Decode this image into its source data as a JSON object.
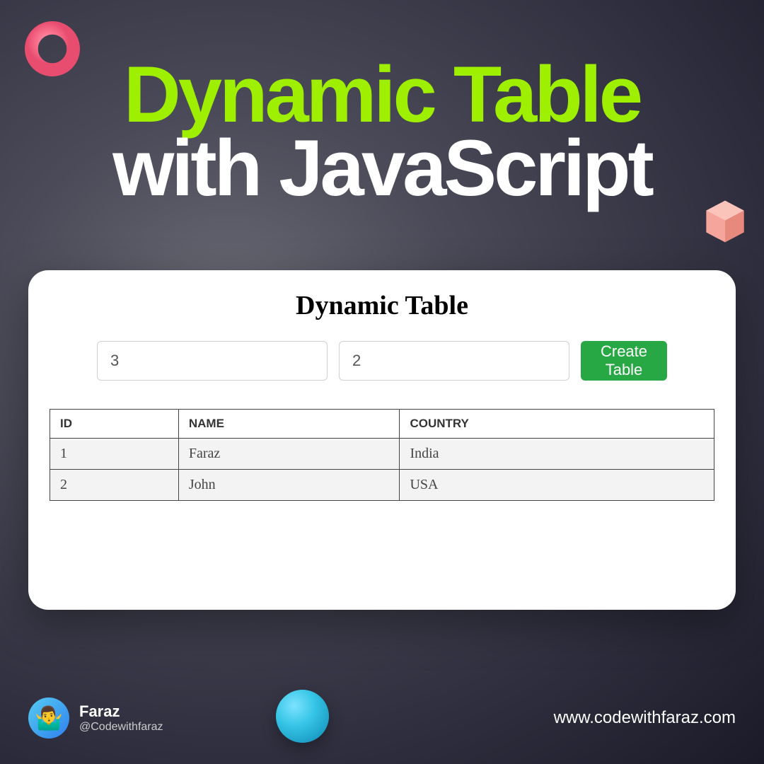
{
  "heading": {
    "line1": "Dynamic Table",
    "line2": "with JavaScript"
  },
  "card": {
    "title": "Dynamic Table",
    "inputs": {
      "rows_value": "3",
      "cols_value": "2"
    },
    "create_button_label": "Create Table",
    "table": {
      "headers": [
        "ID",
        "NAME",
        "COUNTRY"
      ],
      "rows": [
        [
          "1",
          "Faraz",
          "India"
        ],
        [
          "2",
          "John",
          "USA"
        ]
      ]
    }
  },
  "footer": {
    "author_name": "Faraz",
    "author_handle": "@Codewithfaraz",
    "avatar_emoji": "🤷‍♂️",
    "website": "www.codewithfaraz.com"
  },
  "decorations": {
    "torus_color": "#f76c8a",
    "cube_color": "#f28b82",
    "sphere_color": "#36c5e6"
  }
}
